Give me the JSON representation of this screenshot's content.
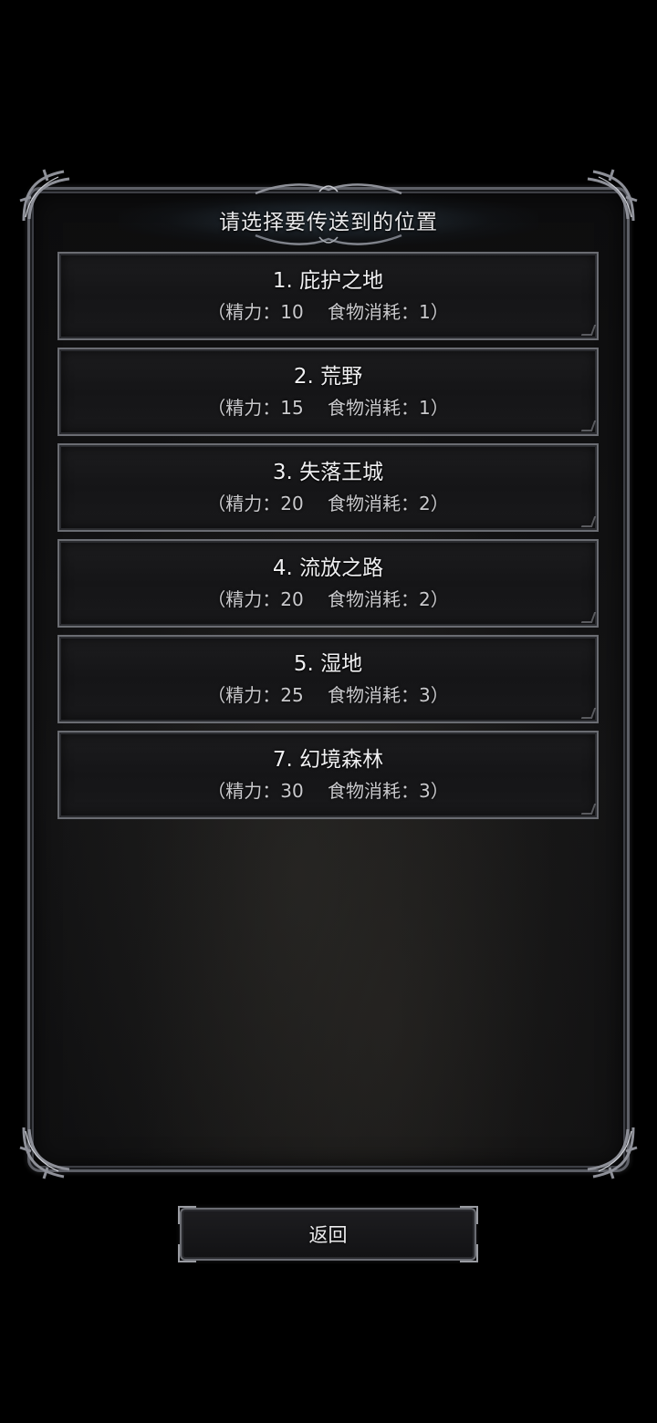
{
  "dialog": {
    "title": "请选择要传送到的位置"
  },
  "locations": [
    {
      "name": "1. 庇护之地",
      "cost": "（精力：10　 食物消耗：1）"
    },
    {
      "name": "2. 荒野",
      "cost": "（精力：15　 食物消耗：1）"
    },
    {
      "name": "3. 失落王城",
      "cost": "（精力：20　 食物消耗：2）"
    },
    {
      "name": "4. 流放之路",
      "cost": "（精力：20　 食物消耗：2）"
    },
    {
      "name": "5. 湿地",
      "cost": "（精力：25　 食物消耗：3）"
    },
    {
      "name": "7. 幻境森林",
      "cost": "（精力：30　 食物消耗：3）"
    }
  ],
  "back_button": {
    "label": "返回"
  },
  "colors": {
    "background": "#000000",
    "panel_border": "#5d5f66",
    "text_primary": "#f0f0f2",
    "text_secondary": "#c9c9cc"
  }
}
